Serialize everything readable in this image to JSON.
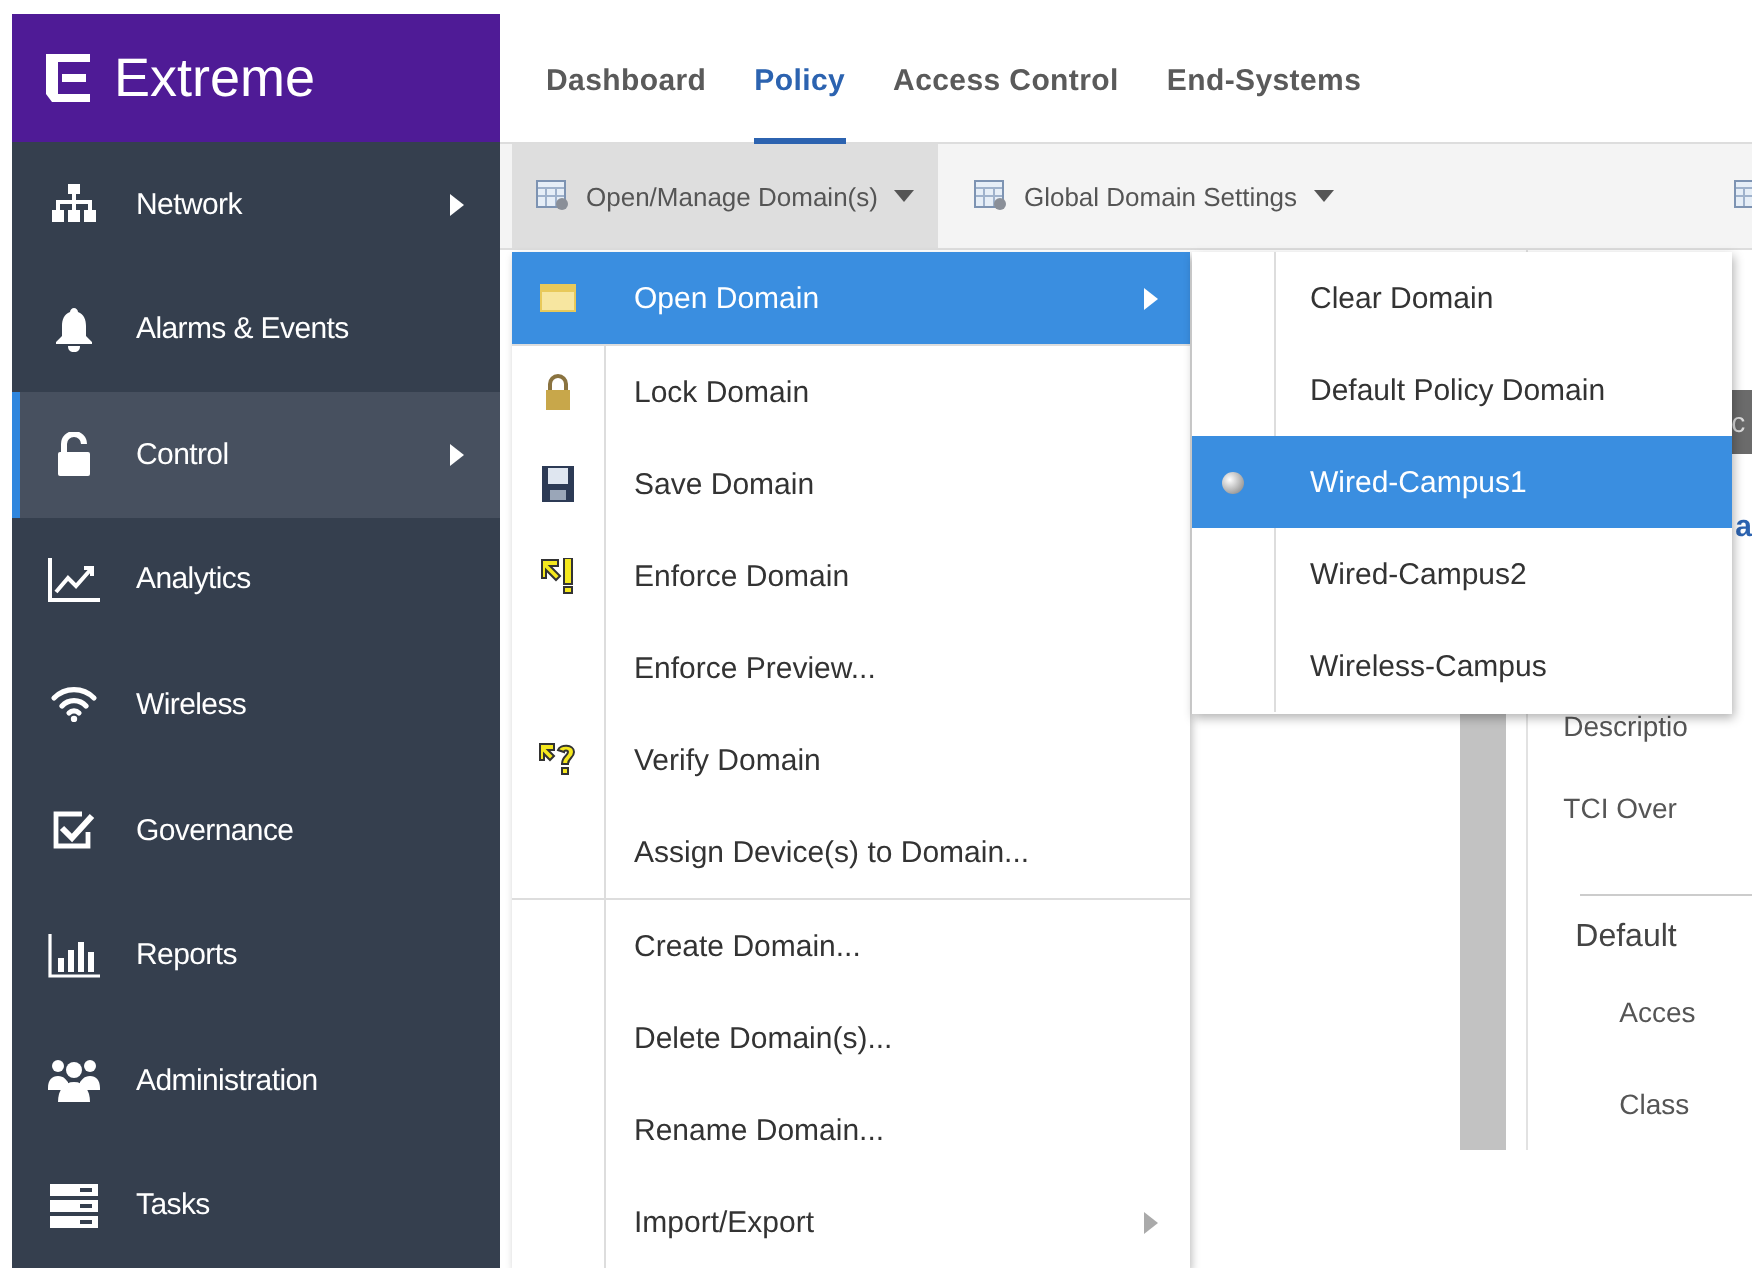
{
  "brand": {
    "name": "Extreme"
  },
  "sidebar": {
    "items": [
      {
        "label": "Network",
        "has_submenu": true,
        "selected": false
      },
      {
        "label": "Alarms & Events",
        "has_submenu": false,
        "selected": false
      },
      {
        "label": "Control",
        "has_submenu": true,
        "selected": true
      },
      {
        "label": "Analytics",
        "has_submenu": false,
        "selected": false
      },
      {
        "label": "Wireless",
        "has_submenu": false,
        "selected": false
      },
      {
        "label": "Governance",
        "has_submenu": false,
        "selected": false
      },
      {
        "label": "Reports",
        "has_submenu": false,
        "selected": false
      },
      {
        "label": "Administration",
        "has_submenu": false,
        "selected": false
      },
      {
        "label": "Tasks",
        "has_submenu": false,
        "selected": false
      }
    ]
  },
  "tabs": [
    {
      "label": "Dashboard",
      "selected": false
    },
    {
      "label": "Policy",
      "selected": true
    },
    {
      "label": "Access Control",
      "selected": false
    },
    {
      "label": "End-Systems",
      "selected": false
    }
  ],
  "toolbar": [
    {
      "label": "Open/Manage Domain(s)",
      "selected": true
    },
    {
      "label": "Global Domain Settings",
      "selected": false
    }
  ],
  "domain_menu": {
    "sections": [
      [
        {
          "label": "Open Domain",
          "highlighted": true,
          "submenu": true
        }
      ],
      [
        {
          "label": "Lock Domain",
          "highlighted": false,
          "submenu": false
        },
        {
          "label": "Save Domain",
          "highlighted": false,
          "submenu": false
        },
        {
          "label": "Enforce Domain",
          "highlighted": false,
          "submenu": false
        },
        {
          "label": "Enforce Preview...",
          "highlighted": false,
          "submenu": false
        },
        {
          "label": "Verify Domain",
          "highlighted": false,
          "submenu": false
        },
        {
          "label": "Assign Device(s) to Domain...",
          "highlighted": false,
          "submenu": false
        }
      ],
      [
        {
          "label": "Create Domain...",
          "highlighted": false,
          "submenu": false
        },
        {
          "label": "Delete Domain(s)...",
          "highlighted": false,
          "submenu": false
        },
        {
          "label": "Rename Domain...",
          "highlighted": false,
          "submenu": false
        },
        {
          "label": "Import/Export",
          "highlighted": false,
          "submenu": true
        }
      ]
    ]
  },
  "open_domain_submenu": {
    "items": [
      {
        "label": "Clear Domain",
        "selected": false
      },
      {
        "label": "Default Policy Domain",
        "selected": false
      },
      {
        "label": "Wired-Campus1",
        "selected": true
      },
      {
        "label": "Wired-Campus2",
        "selected": false
      },
      {
        "label": "Wireless-Campus",
        "selected": false
      }
    ]
  },
  "detail_panel": {
    "banner": "c",
    "link": "a",
    "fields": [
      "Descriptio",
      "TCI Over"
    ],
    "section": "Default",
    "section_fields": [
      "Acces",
      "Class"
    ]
  }
}
